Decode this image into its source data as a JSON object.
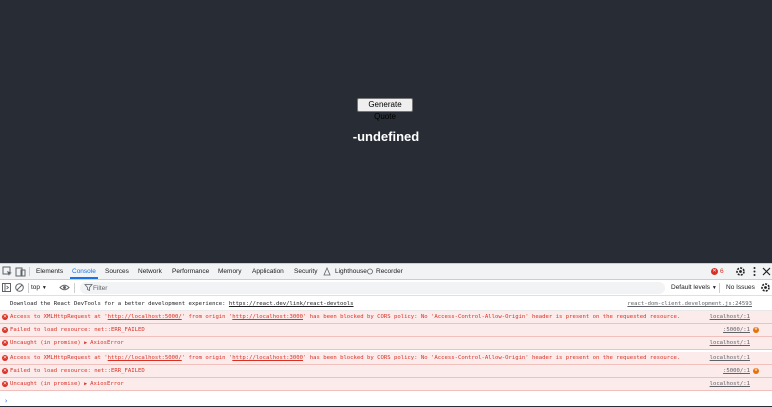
{
  "app": {
    "button_label": "Generate Quote",
    "quote_text": "-undefined"
  },
  "devtools": {
    "tabs": [
      "Elements",
      "Console",
      "Sources",
      "Network",
      "Performance",
      "Memory",
      "Application",
      "Security",
      "Lighthouse",
      "Recorder"
    ],
    "active_tab": "Console",
    "error_count": "6",
    "toolbar": {
      "context": "top",
      "filter_placeholder": "Filter",
      "levels": "Default levels",
      "issues": "No Issues"
    },
    "accent_color": "#1a73e8",
    "error_color": "#d93025",
    "messages": [
      {
        "type": "info",
        "text": "Download the React DevTools for a better development experience: ",
        "link": "https://react.dev/link/react-devtools",
        "source": "react-dom-client.development.js:24593"
      },
      {
        "type": "error",
        "pre": "Access to XMLHttpRequest at '",
        "url1": "http://localhost:5000/",
        "mid": "' from origin '",
        "url2": "http://localhost:3000",
        "post": "' has been blocked by CORS policy: No 'Access-Control-Allow-Origin' header is present on the requested resource.",
        "source": "localhost/:1"
      },
      {
        "type": "error",
        "text": "Failed to load resource: net::ERR_FAILED",
        "source": ":5000/:1"
      },
      {
        "type": "error",
        "pre": "Uncaught (in promise) ",
        "text": "AxiosError",
        "source": "localhost/:1"
      },
      {
        "type": "error",
        "pre": "Access to XMLHttpRequest at '",
        "url1": "http://localhost:5000/",
        "mid": "' from origin '",
        "url2": "http://localhost:3000",
        "post": "' has been blocked by CORS policy: No 'Access-Control-Allow-Origin' header is present on the requested resource.",
        "source": "localhost/:1"
      },
      {
        "type": "error",
        "text": "Failed to load resource: net::ERR_FAILED",
        "source": ":5000/:1"
      },
      {
        "type": "error",
        "pre": "Uncaught (in promise) ",
        "text": "AxiosError",
        "source": "localhost/:1"
      }
    ]
  }
}
